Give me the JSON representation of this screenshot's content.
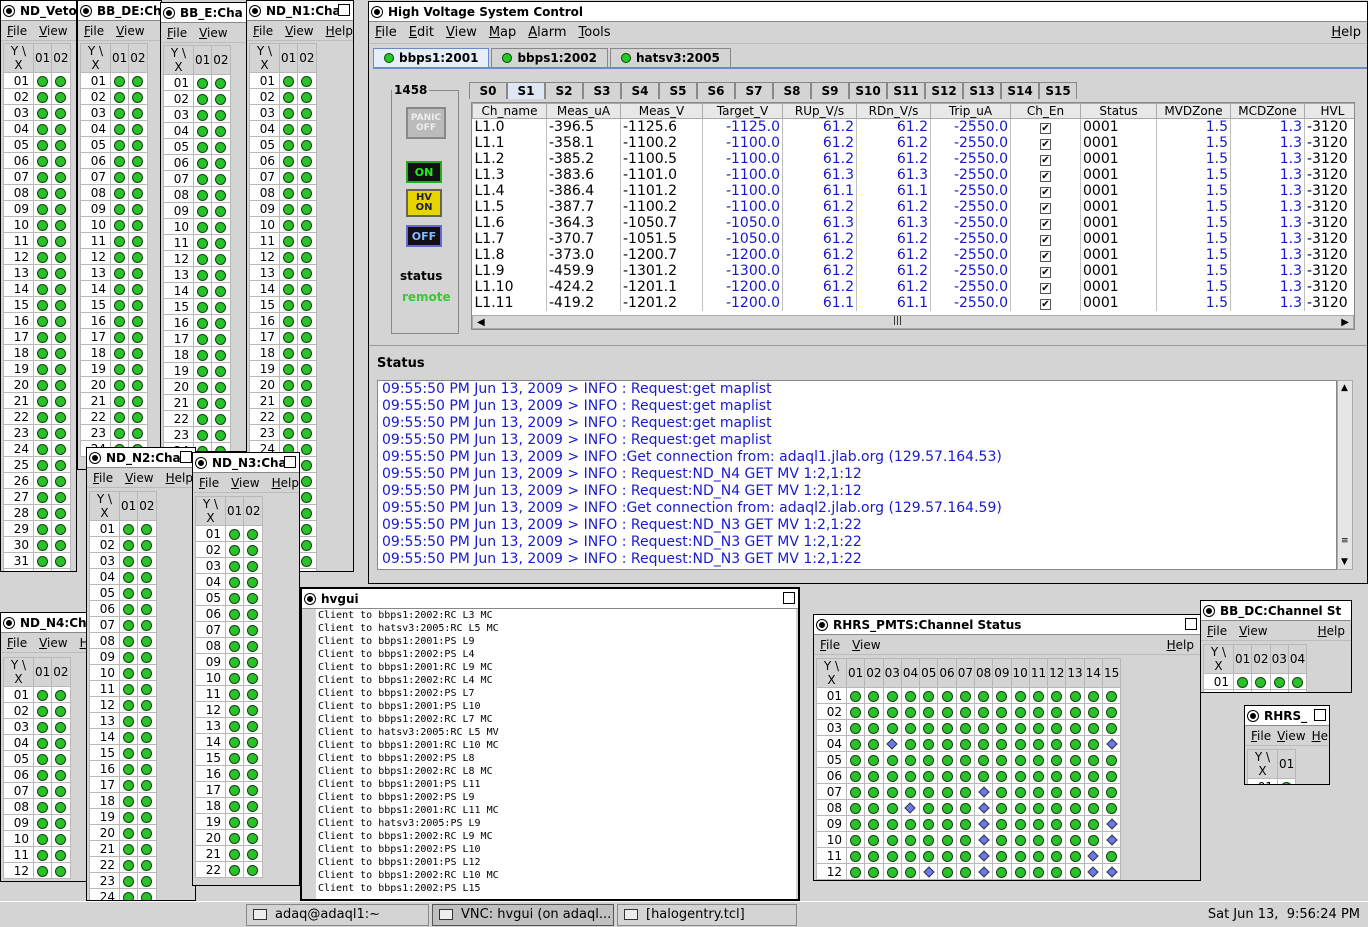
{
  "hv": {
    "title": "High Voltage System Control",
    "menu": [
      "File",
      "Edit",
      "View",
      "Map",
      "Alarm",
      "Tools"
    ],
    "help": "Help",
    "crate_tabs": [
      "bbps1:2001",
      "bbps1:2002",
      "hatsv3:2005"
    ],
    "slot_id": "1458",
    "panic_label": "PANIC OFF",
    "on_label": "ON",
    "hv_on_label": "HV ON",
    "off_label": "OFF",
    "status_label": "status",
    "status_value": "remote",
    "slot_tabs": [
      "S0",
      "S1",
      "S2",
      "S3",
      "S4",
      "S5",
      "S6",
      "S7",
      "S8",
      "S9",
      "S10",
      "S11",
      "S12",
      "S13",
      "S14",
      "S15"
    ],
    "columns": [
      "Ch_name",
      "Meas_uA",
      "Meas_V",
      "Target_V",
      "RUp_V/s",
      "RDn_V/s",
      "Trip_uA",
      "Ch_En",
      "Status",
      "MVDZone",
      "MCDZone",
      "HVL"
    ],
    "rows": [
      [
        "L1.0",
        "-396.5",
        "-1125.6",
        "-1125.0",
        "61.2",
        "61.2",
        "-2550.0",
        "0001",
        "1.5",
        "1.3",
        "-3120"
      ],
      [
        "L1.1",
        "-358.1",
        "-1100.2",
        "-1100.0",
        "61.2",
        "61.2",
        "-2550.0",
        "0001",
        "1.5",
        "1.3",
        "-3120"
      ],
      [
        "L1.2",
        "-385.2",
        "-1100.5",
        "-1100.0",
        "61.2",
        "61.2",
        "-2550.0",
        "0001",
        "1.5",
        "1.3",
        "-3120"
      ],
      [
        "L1.3",
        "-383.6",
        "-1101.0",
        "-1100.0",
        "61.3",
        "61.3",
        "-2550.0",
        "0001",
        "1.5",
        "1.3",
        "-3120"
      ],
      [
        "L1.4",
        "-386.4",
        "-1101.2",
        "-1100.0",
        "61.1",
        "61.1",
        "-2550.0",
        "0001",
        "1.5",
        "1.3",
        "-3120"
      ],
      [
        "L1.5",
        "-387.7",
        "-1100.2",
        "-1100.0",
        "61.2",
        "61.2",
        "-2550.0",
        "0001",
        "1.5",
        "1.3",
        "-3120"
      ],
      [
        "L1.6",
        "-364.3",
        "-1050.7",
        "-1050.0",
        "61.3",
        "61.3",
        "-2550.0",
        "0001",
        "1.5",
        "1.3",
        "-3120"
      ],
      [
        "L1.7",
        "-370.7",
        "-1051.5",
        "-1050.0",
        "61.2",
        "61.2",
        "-2550.0",
        "0001",
        "1.5",
        "1.3",
        "-3120"
      ],
      [
        "L1.8",
        "-373.0",
        "-1200.7",
        "-1200.0",
        "61.2",
        "61.2",
        "-2550.0",
        "0001",
        "1.5",
        "1.3",
        "-3120"
      ],
      [
        "L1.9",
        "-459.9",
        "-1301.2",
        "-1300.0",
        "61.2",
        "61.2",
        "-2550.0",
        "0001",
        "1.5",
        "1.3",
        "-3120"
      ],
      [
        "L1.10",
        "-424.2",
        "-1201.1",
        "-1200.0",
        "61.2",
        "61.2",
        "-2550.0",
        "0001",
        "1.5",
        "1.3",
        "-3120"
      ],
      [
        "L1.11",
        "-419.2",
        "-1201.2",
        "-1200.0",
        "61.1",
        "61.1",
        "-2550.0",
        "0001",
        "1.5",
        "1.3",
        "-3120"
      ]
    ],
    "status_title": "Status",
    "log": [
      "09:55:50 PM Jun 13, 2009 > INFO : Request:get maplist",
      "09:55:50 PM Jun 13, 2009 > INFO : Request:get maplist",
      "09:55:50 PM Jun 13, 2009 > INFO : Request:get maplist",
      "09:55:50 PM Jun 13, 2009 > INFO : Request:get maplist",
      "09:55:50 PM Jun 13, 2009 > INFO :Get connection from: adaql1.jlab.org (129.57.164.53)",
      "09:55:50 PM Jun 13, 2009 > INFO : Request:ND_N4 GET MV 1:2,1:12",
      "09:55:50 PM Jun 13, 2009 > INFO : Request:ND_N4 GET MV 1:2,1:12",
      "09:55:50 PM Jun 13, 2009 > INFO :Get connection from: adaql2.jlab.org (129.57.164.59)",
      "09:55:50 PM Jun 13, 2009 > INFO : Request:ND_N3 GET MV 1:2,1:22",
      "09:55:50 PM Jun 13, 2009 > INFO : Request:ND_N3 GET MV 1:2,1:22",
      "09:55:50 PM Jun 13, 2009 > INFO : Request:ND_N3 GET MV 1:2,1:22"
    ]
  },
  "hvgui": {
    "title": "hvgui",
    "lines": [
      "Client to bbps1:2002:RC L3 MC",
      "Client to hatsv3:2005:RC L5 MC",
      "Client to bbps1:2001:PS L9",
      "Client to bbps1:2002:PS L4",
      "Client to bbps1:2001:RC L9 MC",
      "Client to bbps1:2002:RC L4 MC",
      "Client to bbps1:2002:PS L7",
      "Client to bbps1:2001:PS L10",
      "Client to bbps1:2002:RC L7 MC",
      "Client to hatsv3:2005:RC L5 MV",
      "Client to bbps1:2001:RC L10 MC",
      "Client to bbps1:2002:PS L8",
      "Client to bbps1:2002:RC L8 MC",
      "Client to bbps1:2001:PS L11",
      "Client to bbps1:2002:PS L9",
      "Client to bbps1:2001:RC L11 MC",
      "Client to hatsv3:2005:PS L9",
      "Client to bbps1:2002:RC L9 MC",
      "Client to bbps1:2002:PS L10",
      "Client to bbps1:2001:PS L12",
      "Client to bbps1:2002:RC L10 MC",
      "Client to bbps1:2002:PS L15"
    ]
  },
  "small_windows": {
    "nd_veto": {
      "title": "ND_Veto:",
      "menu": [
        "File",
        "View"
      ],
      "rows": 32,
      "cols": [
        "01",
        "02"
      ]
    },
    "bb_de": {
      "title": "BB_DE:Ch",
      "menu": [
        "File",
        "View"
      ],
      "rows": 24,
      "cols": [
        "01",
        "02"
      ]
    },
    "bb_e": {
      "title": "BB_E:Cha",
      "menu": [
        "File",
        "View"
      ],
      "rows": 24,
      "cols": [
        "01",
        "02"
      ]
    },
    "nd_n1": {
      "title": "ND_N1:Cha",
      "menu": [
        "File",
        "View",
        "Help"
      ],
      "rows": 32,
      "cols": [
        "01",
        "02"
      ]
    },
    "nd_n2": {
      "title": "ND_N2:Cha",
      "menu": [
        "File",
        "View",
        "Help"
      ],
      "rows": 24,
      "cols": [
        "01",
        "02"
      ]
    },
    "nd_n3": {
      "title": "ND_N3:Cha",
      "menu": [
        "File",
        "View",
        "Help"
      ],
      "rows": 22,
      "cols": [
        "01",
        "02"
      ]
    },
    "nd_n4": {
      "title": "ND_N4:Ch",
      "menu": [
        "File",
        "View",
        "H"
      ],
      "rows": 12,
      "cols": [
        "01",
        "02"
      ]
    },
    "rhrs_pmts": {
      "title": "RHRS_PMTS:Channel Status",
      "menu": [
        "File",
        "View"
      ],
      "help": "Help",
      "rows": 12,
      "cols": [
        "01",
        "02",
        "03",
        "04",
        "05",
        "06",
        "07",
        "08",
        "09",
        "10",
        "11",
        "12",
        "13",
        "14",
        "15"
      ]
    },
    "bb_dc": {
      "title": "BB_DC:Channel St",
      "menu": [
        "File",
        "View"
      ],
      "help": "Help",
      "rows": 2,
      "cols": [
        "01",
        "02",
        "03",
        "04"
      ]
    },
    "rhrs": {
      "title": "RHRS_",
      "menu": [
        "File",
        "View"
      ],
      "help": "Help",
      "rows": 1,
      "cols": [
        "01"
      ]
    },
    "corner": "Y \\ X"
  },
  "taskbar": {
    "tasks": [
      "adaq@adaql1:~",
      "VNC: hvgui (on adaql...",
      "[halogentry.tcl]"
    ],
    "clock": "Sat Jun 13,  9:56:24 PM"
  }
}
